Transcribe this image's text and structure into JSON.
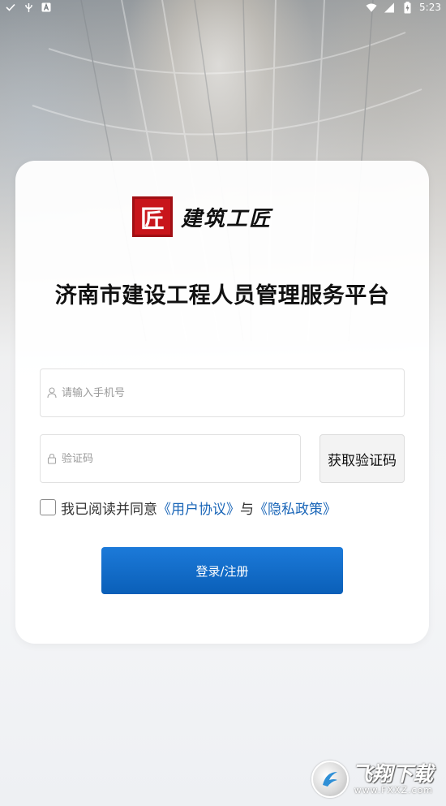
{
  "status_bar": {
    "time": "5:23",
    "left_icons": [
      "check-icon",
      "usb-icon",
      "a-badge-icon"
    ],
    "right_icons": [
      "wifi-icon",
      "signal-icon",
      "battery-charging-icon"
    ]
  },
  "logo": {
    "mark": "匠",
    "text": "建筑工匠"
  },
  "title": "济南市建设工程人员管理服务平台",
  "form": {
    "phone_placeholder": "请输入手机号",
    "code_placeholder": "验证码",
    "get_code_label": "获取验证码"
  },
  "agreement": {
    "prefix": "我已阅读并同意",
    "user_agreement": "《用户协议》",
    "connector": "与",
    "privacy_policy": "《隐私政策》",
    "checked": false
  },
  "login_button": "登录/注册",
  "watermark": {
    "name": "飞翔下载",
    "url": "www.FXXZ.com"
  },
  "colors": {
    "brand_red": "#c8151b",
    "link_blue": "#1a66b8",
    "button_blue": "#0a6ac8"
  }
}
